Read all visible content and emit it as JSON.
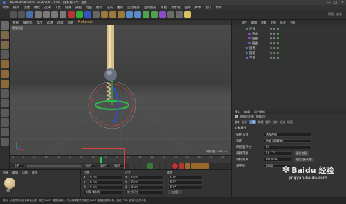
{
  "window": {
    "title": "CINEMA 4D R19.024 Studio (RC - R19) - [未标题 1 *] - 主要"
  },
  "menu": {
    "items": [
      "文件",
      "编辑",
      "创建",
      "模式",
      "选择",
      "工具",
      "网格",
      "捕捉",
      "动画",
      "模拟",
      "渲染",
      "雕刻",
      "运动跟踪",
      "运动图形",
      "角色",
      "流水线",
      "插件",
      "脚本",
      "窗口",
      "帮助"
    ]
  },
  "viewport": {
    "menu": [
      "查看",
      "摄像机",
      "显示",
      "选项",
      "过滤",
      "面板",
      "ProRender"
    ],
    "label": "透视视图",
    "grid_info": "网格间距：100 cm"
  },
  "object_manager": {
    "tabs": [
      "文件",
      "编辑",
      "查看",
      "对象",
      "标签",
      "书签"
    ],
    "items": [
      "连接",
      "弯曲",
      "扭曲",
      "扭曲",
      "摄像",
      "圆锥",
      "平面"
    ]
  },
  "attributes": {
    "tabs": [
      "模式",
      "编辑",
      "用户数据"
    ],
    "object_label": "摄像机对象 [摄像机]",
    "subtabs": [
      "基本",
      "坐标",
      "对象",
      "物理",
      "细节",
      "立体",
      "合成",
      "球面"
    ],
    "section": "对象属性",
    "rows": [
      {
        "label": "投射方式",
        "value": "透视视图"
      },
      {
        "label": "焦距",
        "value": "经典 (36毫米)"
      },
      {
        "label": "传感器尺寸",
        "value": "36"
      },
      {
        "label": "视野范围",
        "value": "53.13°"
      },
      {
        "label": "目标距离",
        "value": "2000 cm"
      },
      {
        "label": "白平衡",
        "value": "6500"
      }
    ],
    "buttons": [
      "更多信息",
      "使用目标对象"
    ]
  },
  "timeline": {
    "ticks": [
      "0",
      "5",
      "10",
      "15",
      "20",
      "25",
      "30",
      "35",
      "40",
      "45",
      "50",
      "55",
      "60",
      "65",
      "70",
      "75",
      "80",
      "85",
      "90"
    ],
    "current_frame": "30 F",
    "start_field": "0 F",
    "end_field": "90 F",
    "fps_field": "90 F"
  },
  "coordinates": {
    "headers": [
      "位置",
      "尺寸",
      "旋转"
    ],
    "rows": [
      {
        "axis": "X",
        "pos": "0 cm",
        "size": "0 cm",
        "rot": "H 0°"
      },
      {
        "axis": "Y",
        "pos": "0 cm",
        "size": "0 cm",
        "rot": "P 0°"
      },
      {
        "axis": "Z",
        "pos": "0 cm",
        "size": "0 cm",
        "rot": "B 0°"
      }
    ],
    "mode": "对象 (相对)",
    "size_mode": "绝对尺寸",
    "apply": "应用"
  },
  "materials": {
    "menu": [
      "创建",
      "编辑",
      "功能",
      "纹理"
    ],
    "item": "材质"
  },
  "status": {
    "text": "移动：点击并拖动鼠标移动元素。按住 SHIFT 键量化移动；节点编辑模式时按住 SHIFT 键增加选择对象；按住 CTRL 键减少选择对象。"
  },
  "watermark": {
    "text": "Baidu 经验",
    "url": "jingyan.baidu.com"
  },
  "colors": {
    "highlight_box": "#e03c3c",
    "accent": "#ffb84d",
    "playhead": "#36c456"
  }
}
